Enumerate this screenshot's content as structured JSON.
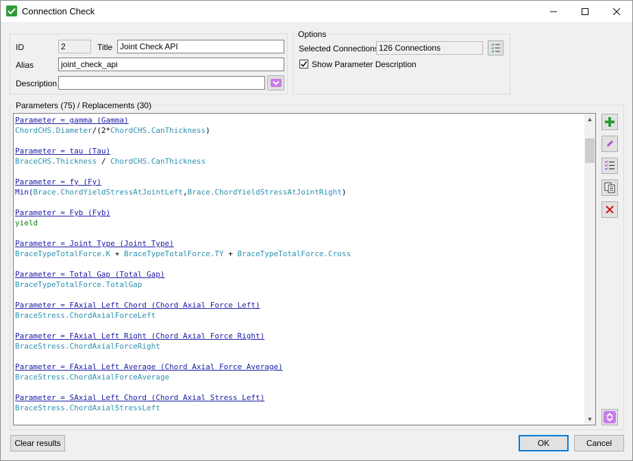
{
  "window": {
    "title": "Connection Check",
    "minimize_icon": "minimize-icon",
    "maximize_icon": "maximize-icon",
    "close_icon": "close-icon"
  },
  "general": {
    "id_label": "ID",
    "id_value": "2",
    "title_label": "Title",
    "title_value": "Joint Check API",
    "alias_label": "Alias",
    "alias_value": "joint_check_api",
    "description_label": "Description",
    "description_value": ""
  },
  "options": {
    "legend": "Options",
    "selected_connections_label": "Selected Connections",
    "selected_connections_value": "126 Connections",
    "show_param_desc_label": "Show Parameter Description",
    "show_param_desc_checked": true
  },
  "parameters": {
    "legend": "Parameters (75) / Replacements (30)",
    "entries": [
      {
        "param": "Parameter = gamma (Gamma)",
        "expr": [
          {
            "t": "ChordCHS.Diameter",
            "c": "blue"
          },
          {
            "t": "/(2*",
            "c": "black"
          },
          {
            "t": "ChordCHS.CanThickness",
            "c": "blue"
          },
          {
            "t": ")",
            "c": "black"
          }
        ]
      },
      {
        "param": "Parameter = tau (Tau)",
        "expr": [
          {
            "t": "BraceCHS.Thickness",
            "c": "blue"
          },
          {
            "t": " / ",
            "c": "black"
          },
          {
            "t": "ChordCHS.CanThickness",
            "c": "blue"
          }
        ]
      },
      {
        "param": "Parameter = fy (Fy)",
        "expr": [
          {
            "t": "Min(",
            "c": "func"
          },
          {
            "t": "Brace.ChordYieldStressAtJointLeft",
            "c": "blue"
          },
          {
            "t": ",",
            "c": "black"
          },
          {
            "t": "Brace.ChordYieldStressAtJointRight",
            "c": "blue"
          },
          {
            "t": ")",
            "c": "black"
          }
        ]
      },
      {
        "param": "Parameter = Fyb (Fyb)",
        "expr": [
          {
            "t": "yield",
            "c": "green"
          }
        ]
      },
      {
        "param": "Parameter = Joint Type (Joint Type)",
        "expr": [
          {
            "t": "BraceTypeTotalForce.K",
            "c": "blue"
          },
          {
            "t": " + ",
            "c": "black"
          },
          {
            "t": "BraceTypeTotalForce.TY",
            "c": "blue"
          },
          {
            "t": " + ",
            "c": "black"
          },
          {
            "t": "BraceTypeTotalForce.Cross",
            "c": "blue"
          }
        ]
      },
      {
        "param": "Parameter = Total Gap (Total Gap)",
        "expr": [
          {
            "t": "BraceTypeTotalForce.TotalGap",
            "c": "blue"
          }
        ]
      },
      {
        "param": "Parameter = FAxial Left Chord (Chord Axial Force Left)",
        "expr": [
          {
            "t": "BraceStress.ChordAxialForceLeft",
            "c": "blue"
          }
        ]
      },
      {
        "param": "Parameter = FAxial Left Right (Chord Axial Force Right)",
        "expr": [
          {
            "t": "BraceStress.ChordAxialForceRight",
            "c": "blue"
          }
        ]
      },
      {
        "param": "Parameter = FAxial Left Average (Chord Axial Force Average)",
        "expr": [
          {
            "t": "BraceStress.ChordAxialForceAverage",
            "c": "blue"
          }
        ]
      },
      {
        "param": "Parameter = SAxial Left Chord (Chord Axial Stress Left)",
        "expr": [
          {
            "t": "BraceStress.ChordAxialStressLeft",
            "c": "blue"
          }
        ]
      }
    ]
  },
  "side_tools": [
    {
      "name": "add-button",
      "icon": "plus-icon",
      "color": "#2e9b3a"
    },
    {
      "name": "edit-button",
      "icon": "pencil-icon",
      "color": "#a64bd6"
    },
    {
      "name": "list-button",
      "icon": "checklist-icon",
      "color": "#555555"
    },
    {
      "name": "copy-button",
      "icon": "copy-icon",
      "color": "#555555"
    },
    {
      "name": "delete-button",
      "icon": "delete-icon",
      "color": "#d11a1a"
    }
  ],
  "footer": {
    "clear_results_label": "Clear results",
    "ok_label": "OK",
    "cancel_label": "Cancel"
  },
  "colors": {
    "accent": "#0078d7",
    "param_link": "#1a1aa8",
    "identifier": "#2b91af",
    "keyword_green": "#0b7a0b",
    "purple_icon": "#a64bd6"
  }
}
